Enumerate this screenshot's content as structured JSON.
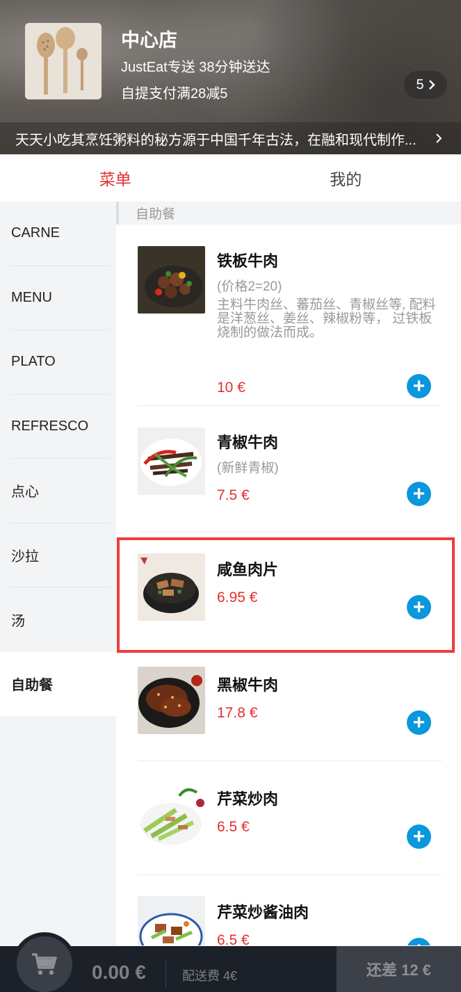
{
  "header": {
    "shop_name": "中心店",
    "delivery": "JustEat专送 38分钟送达",
    "promo": "自提支付满28减5",
    "promo_count": "5",
    "notice": "天天小吃其烹饪粥料的秘方源于中国千年古法，在融和现代制作..."
  },
  "tabs": [
    {
      "label": "菜单",
      "active": true
    },
    {
      "label": "我的",
      "active": false
    }
  ],
  "sidebar": {
    "items": [
      {
        "label": "CARNE"
      },
      {
        "label": "MENU"
      },
      {
        "label": "PLATO"
      },
      {
        "label": "REFRESCO"
      },
      {
        "label": "点心"
      },
      {
        "label": "沙拉"
      },
      {
        "label": "汤"
      },
      {
        "label": "自助餐",
        "active": true
      }
    ]
  },
  "menu": {
    "section": "自助餐",
    "items": [
      {
        "name": "铁板牛肉",
        "sub": "(价格2=20)",
        "desc": "主料牛肉丝、蕃茄丝、青椒丝等, 配料是洋葱丝、姜丝、辣椒粉等， 过铁板烧制的做法而成。",
        "price": "10 €"
      },
      {
        "name": "青椒牛肉",
        "sub": "(新鲜青椒)",
        "price": "7.5 €"
      },
      {
        "name": "咸鱼肉片",
        "price": "6.95 €"
      },
      {
        "name": "黑椒牛肉",
        "price": "17.8 €"
      },
      {
        "name": "芹菜炒肉",
        "price": "6.5 €"
      },
      {
        "name": "芹菜炒酱油肉",
        "price": "6.5 €"
      }
    ]
  },
  "cart": {
    "total": "0.00 €",
    "delivery_fee": "配送费 4€",
    "checkout": "还差 12 €"
  },
  "colors": {
    "accent_red": "#e52f2f",
    "add_blue": "#0b97dd",
    "highlight": "#ef3b3b",
    "cart_bar": "#1c2129"
  }
}
